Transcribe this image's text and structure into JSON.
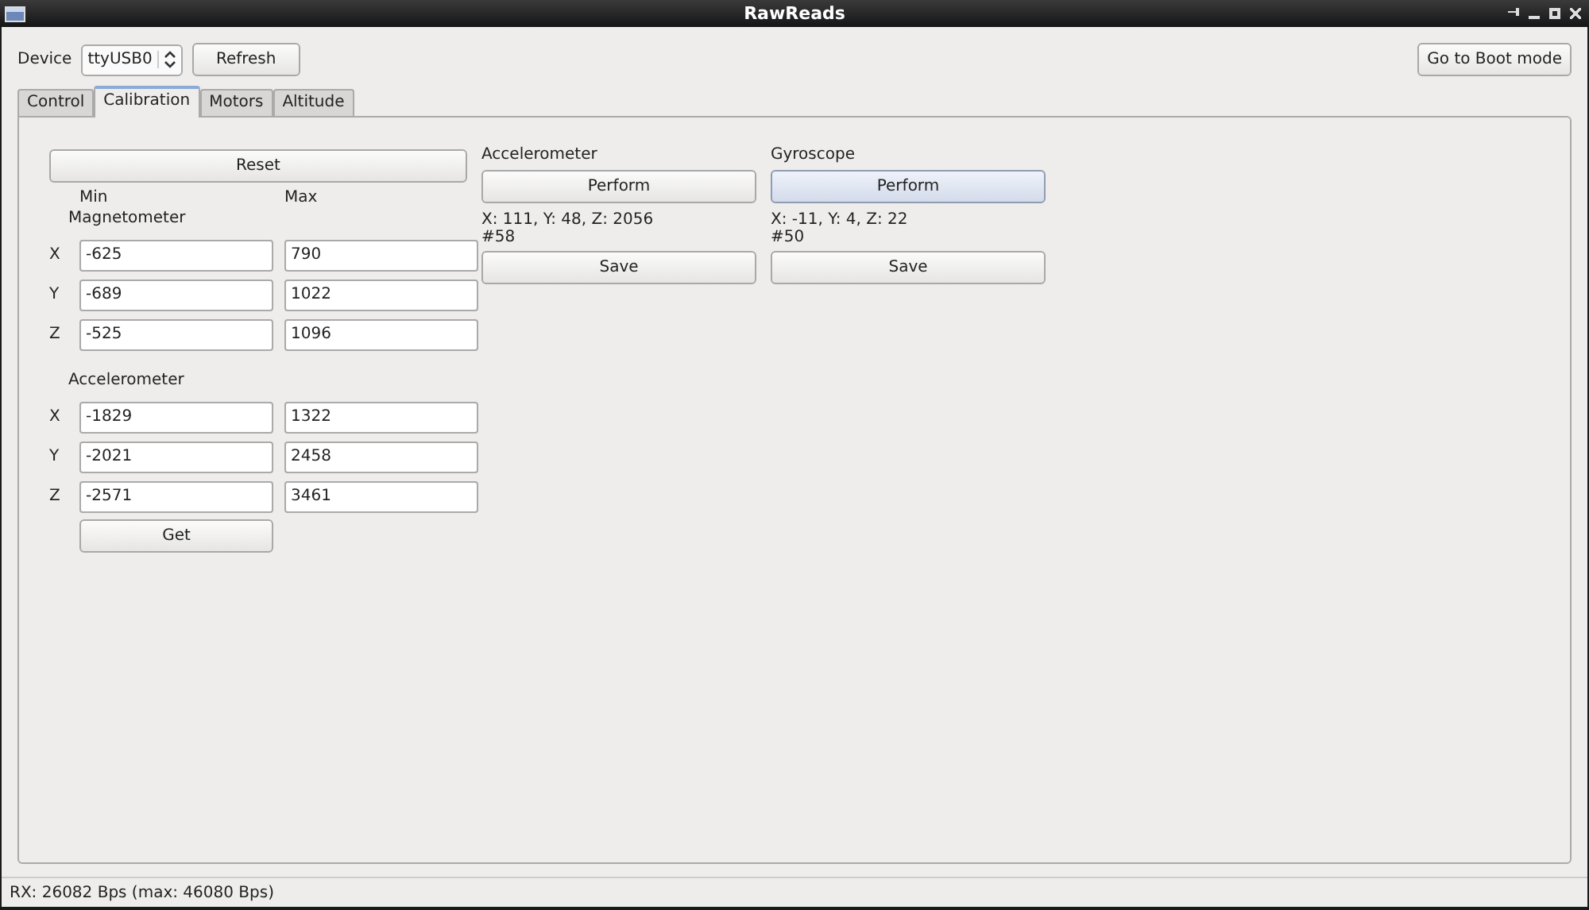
{
  "window": {
    "title": "RawReads"
  },
  "device": {
    "label": "Device",
    "value": "ttyUSB0"
  },
  "refresh_button": "Refresh",
  "boot_button": "Go to Boot mode",
  "tabs": [
    {
      "label": "Control",
      "selected": false
    },
    {
      "label": "Calibration",
      "selected": true
    },
    {
      "label": "Motors",
      "selected": false
    },
    {
      "label": "Altitude",
      "selected": false
    }
  ],
  "calibration": {
    "reset_button": "Reset",
    "min_label": "Min",
    "max_label": "Max",
    "groups": [
      {
        "title": "Magnetometer",
        "rows": [
          {
            "axis": "X",
            "min": "-625",
            "max": "790"
          },
          {
            "axis": "Y",
            "min": "-689",
            "max": "1022"
          },
          {
            "axis": "Z",
            "min": "-525",
            "max": "1096"
          }
        ]
      },
      {
        "title": "Accelerometer",
        "rows": [
          {
            "axis": "X",
            "min": "-1829",
            "max": "1322"
          },
          {
            "axis": "Y",
            "min": "-2021",
            "max": "2458"
          },
          {
            "axis": "Z",
            "min": "-2571",
            "max": "3461"
          }
        ]
      }
    ],
    "get_button": "Get"
  },
  "sensors": [
    {
      "title": "Accelerometer",
      "perform_button": "Perform",
      "hovered": false,
      "reading": "X: 111, Y: 48, Z: 2056",
      "count": "#58",
      "save_button": "Save"
    },
    {
      "title": "Gyroscope",
      "perform_button": "Perform",
      "hovered": true,
      "reading": "X: -11, Y: 4, Z: 22",
      "count": "#50",
      "save_button": "Save"
    }
  ],
  "status_bar": "RX: 26082 Bps (max: 46080 Bps)"
}
